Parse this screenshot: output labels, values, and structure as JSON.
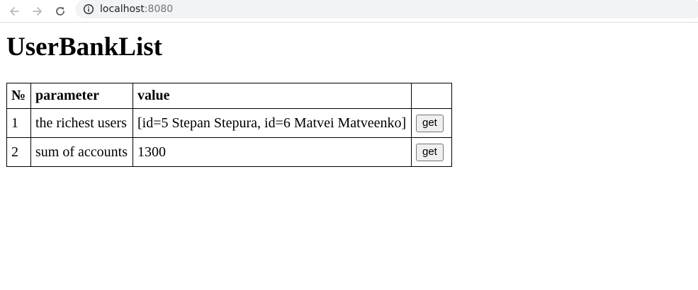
{
  "browser": {
    "url_host": "localhost",
    "url_port": ":8080"
  },
  "page": {
    "title": "UserBankList"
  },
  "table": {
    "headers": [
      "№",
      "parameter",
      "value",
      ""
    ],
    "rows": [
      {
        "num": "1",
        "parameter": "the richest users",
        "value": "[id=5 Stepan Stepura, id=6 Matvei Matveenko]",
        "button": "get"
      },
      {
        "num": "2",
        "parameter": "sum of accounts",
        "value": "1300",
        "button": "get"
      }
    ]
  },
  "icons": {
    "back": "arrow-left-icon",
    "forward": "arrow-right-icon",
    "reload": "reload-icon",
    "site_info": "info-icon"
  }
}
